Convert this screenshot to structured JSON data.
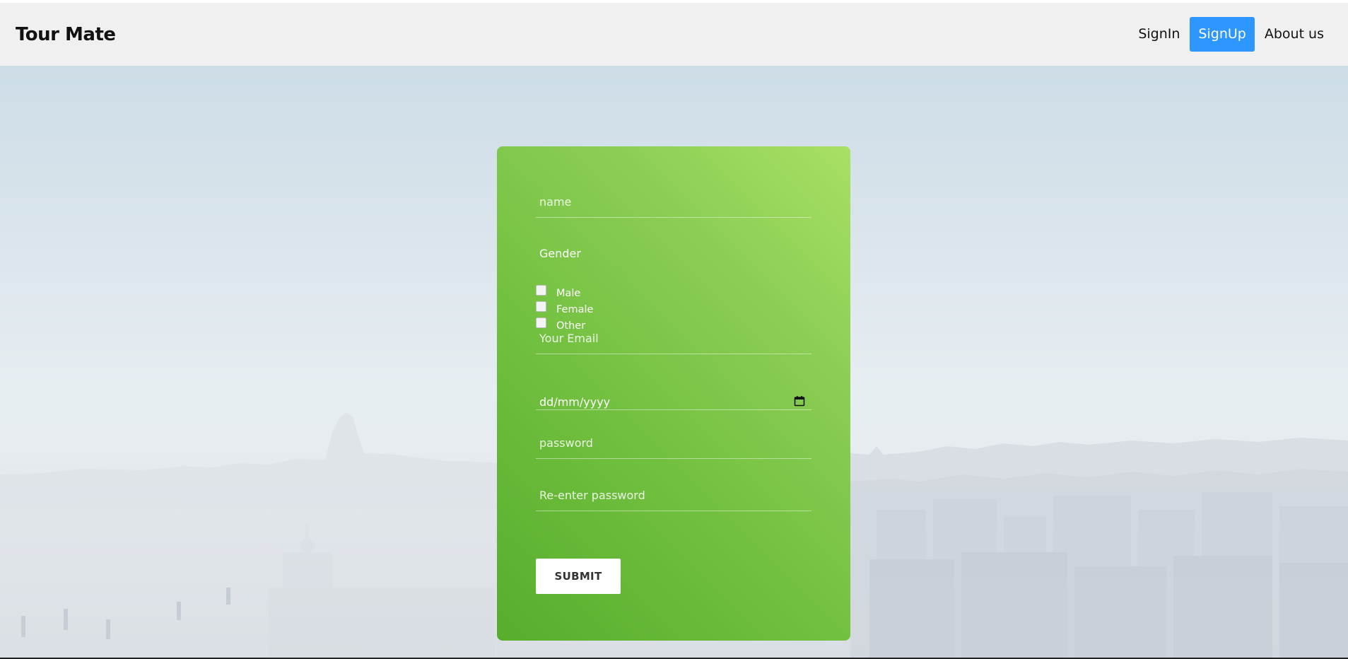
{
  "brand": {
    "name": "Tour Mate"
  },
  "nav": {
    "signin": "SignIn",
    "signup": "SignUp",
    "about": "About us",
    "active_color": "#2e96ff"
  },
  "form": {
    "name_placeholder": "name",
    "gender_label": "Gender",
    "gender_options": [
      "Male",
      "Female",
      "Other"
    ],
    "email_placeholder": "Your Email",
    "date_placeholder": "dd/mm/yyyy",
    "password_placeholder": "password",
    "reenter_placeholder": "Re-enter password",
    "submit_label": "SUBMIT",
    "card_gradient": [
      "#a8e063",
      "#58ad2c"
    ],
    "date_icon": "calendar-icon"
  }
}
